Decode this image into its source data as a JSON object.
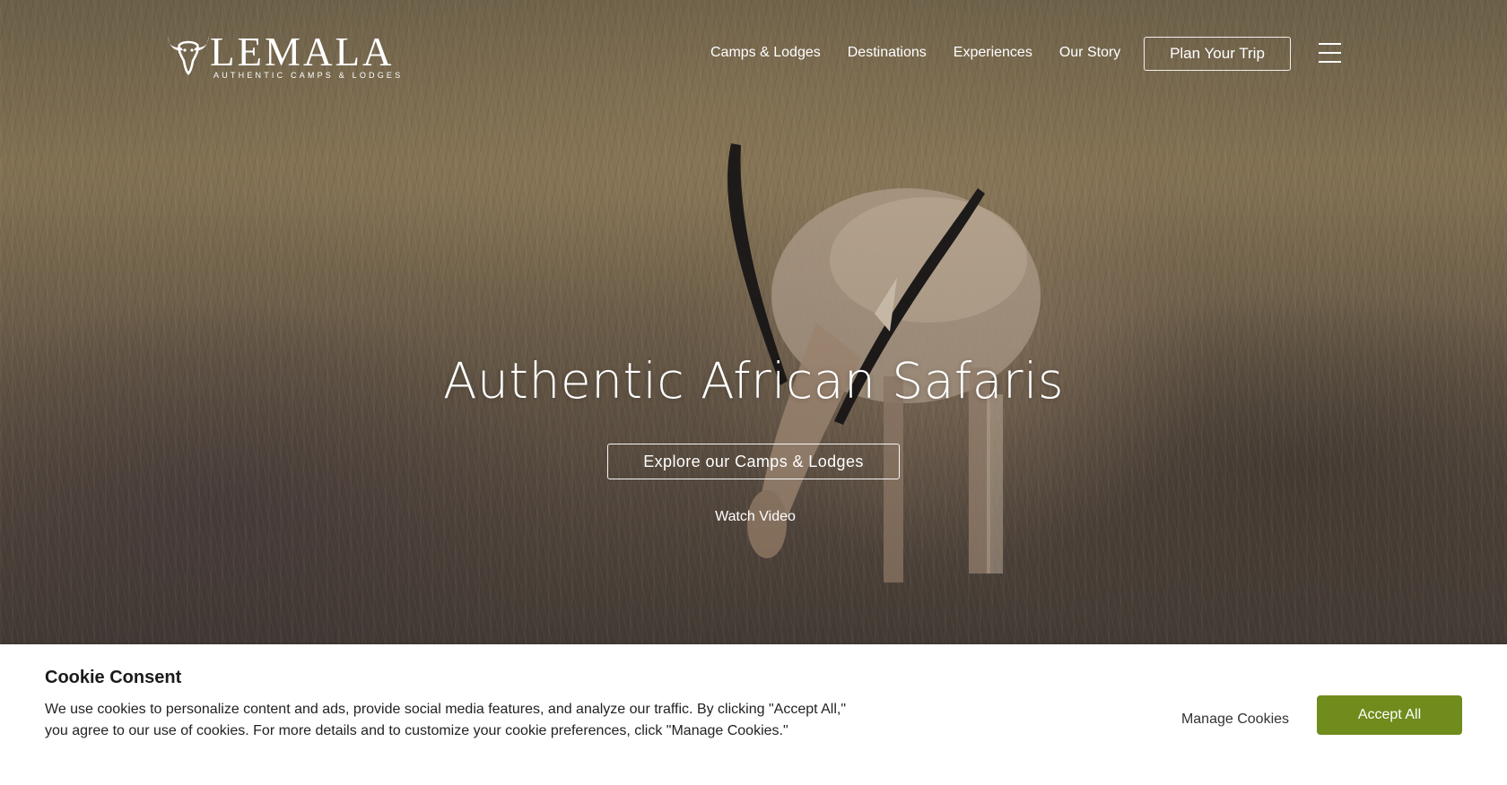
{
  "header": {
    "logo": {
      "wordmark": "LEMALA",
      "tagline": "AUTHENTIC CAMPS & LODGES",
      "icon": "buffalo-skull-icon"
    },
    "nav": [
      {
        "label": "Camps & Lodges"
      },
      {
        "label": "Destinations"
      },
      {
        "label": "Experiences"
      },
      {
        "label": "Our Story"
      }
    ],
    "cta_label": "Plan Your Trip",
    "menu_icon": "hamburger-menu-icon"
  },
  "hero": {
    "title": "Authentic African Safaris",
    "primary_button": "Explore our Camps & Lodges",
    "secondary_link": "Watch Video",
    "background": "gazelle-grazing-in-grass"
  },
  "cookie_banner": {
    "title": "Cookie Consent",
    "text": "We use cookies to personalize content and ads, provide social media features, and analyze our traffic. By clicking \"Accept All,\" you agree to our use of cookies. For more details and to customize your cookie preferences, click \"Manage Cookies.\"",
    "manage_label": "Manage Cookies",
    "accept_label": "Accept All",
    "accept_color": "#6f8c1c"
  }
}
